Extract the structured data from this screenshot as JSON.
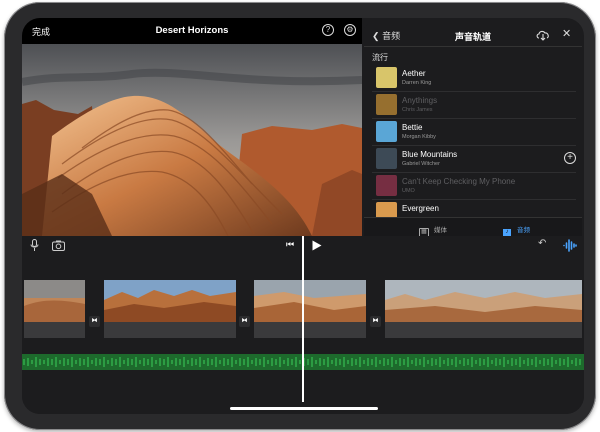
{
  "header": {
    "done_label": "完成",
    "project_title": "Desert Horizons",
    "help_icon": "question-circle-icon",
    "settings_icon": "gear-icon"
  },
  "panel": {
    "back_label": "音频",
    "title": "声音轨道",
    "section": "流行",
    "tracks": [
      {
        "name": "Aether",
        "artist": "Darren King",
        "thumb": "#d8c56a",
        "available": true
      },
      {
        "name": "Anythings",
        "artist": "Chris James",
        "thumb": "#e8a63a",
        "available": false
      },
      {
        "name": "Bettie",
        "artist": "Morgan Kibby",
        "thumb": "#5aa6d6",
        "available": true
      },
      {
        "name": "Blue Mountains",
        "artist": "Gabriel Witcher",
        "thumb": "#3d4a56",
        "available": true
      },
      {
        "name": "Can't Keep Checking My Phone",
        "artist": "UMO",
        "thumb": "#b23a5a",
        "available": false
      },
      {
        "name": "Evergreen",
        "artist": "",
        "thumb": "#d99a4e",
        "available": true
      }
    ],
    "tabs": {
      "media": "媒体",
      "audio": "音频"
    }
  },
  "colors": {
    "accent": "#4aa4ff",
    "audio_wave": "#2fb34a"
  }
}
